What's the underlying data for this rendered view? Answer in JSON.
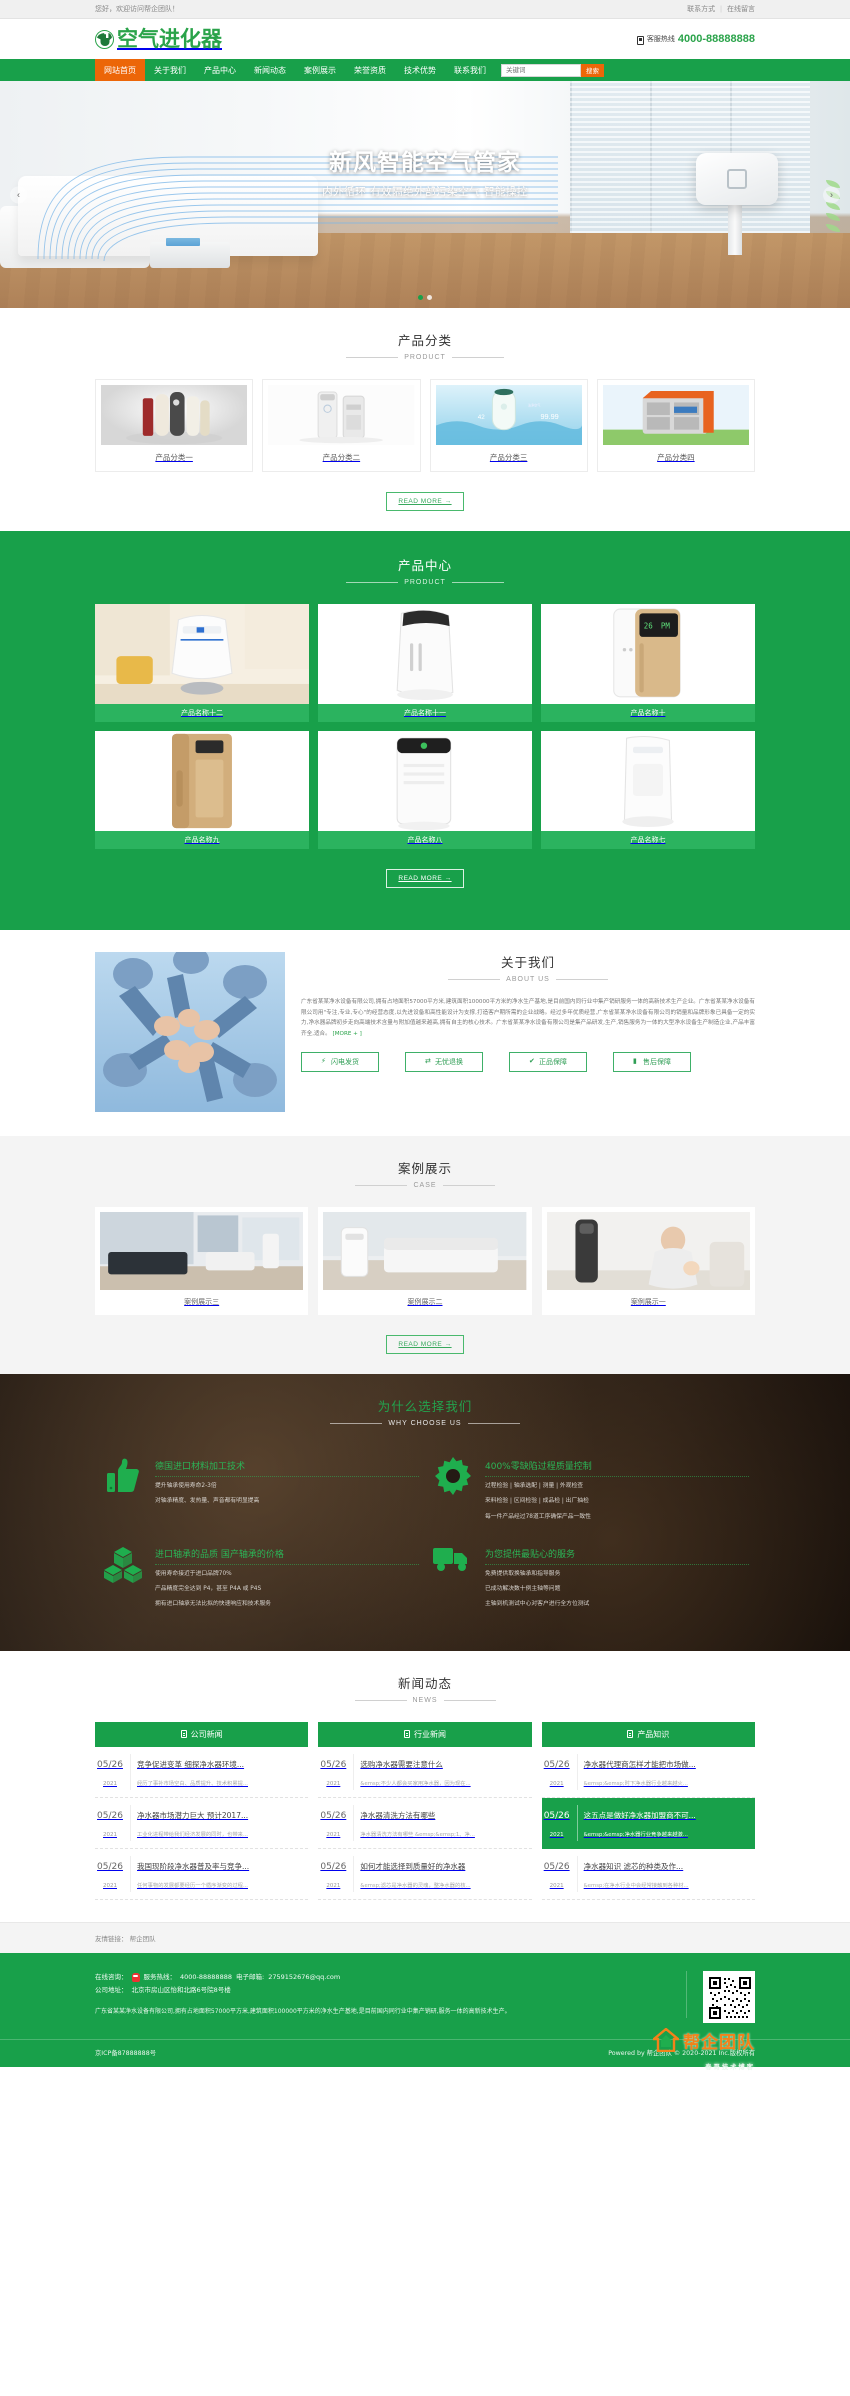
{
  "topbar": {
    "welcome": "您好，欢迎访问帮企团队！",
    "links": [
      {
        "label": "联系方式"
      },
      {
        "label": "在线留言"
      }
    ],
    "separator": "|"
  },
  "header": {
    "logo_text": "空气进化器",
    "logo_icon": "leaf-sprout-icon",
    "hotline_icon": "phone-icon",
    "hotline_label": "客服热线",
    "hotline_number": "4000-88888888"
  },
  "nav": {
    "items": [
      {
        "label": "网站首页",
        "active": true
      },
      {
        "label": "关于我们",
        "active": false
      },
      {
        "label": "产品中心",
        "active": false
      },
      {
        "label": "新闻动态",
        "active": false
      },
      {
        "label": "案例展示",
        "active": false
      },
      {
        "label": "荣誉资质",
        "active": false
      },
      {
        "label": "技术优势",
        "active": false
      },
      {
        "label": "联系我们",
        "active": false
      }
    ],
    "search_placeholder": "关键词",
    "search_value": "",
    "search_button": "搜索"
  },
  "hero": {
    "title": "新风智能空气管家",
    "subtitle": "内外循环 有效隔绝外部污染空气 智能操控",
    "prev_icon": "chevron-left-icon",
    "next_icon": "chevron-right-icon",
    "dots": 2,
    "active_dot": 0
  },
  "category": {
    "title": "产品分类",
    "subtitle": "PRODUCT",
    "items": [
      {
        "name": "产品分类一",
        "image": "water-purifier-group"
      },
      {
        "name": "产品分类二",
        "image": "tower-purifier-pair"
      },
      {
        "name": "产品分类三",
        "image": "water-splash-purifier"
      },
      {
        "name": "产品分类四",
        "image": "orange-air-cooler"
      }
    ],
    "read_more": "READ MORE →"
  },
  "product_center": {
    "title": "产品中心",
    "subtitle": "PRODUCT",
    "items": [
      {
        "name": "产品名称十二",
        "image": "white-purifier-room"
      },
      {
        "name": "产品名称十一",
        "image": "white-slim-purifier"
      },
      {
        "name": "产品名称十",
        "image": "gold-panel-purifier"
      },
      {
        "name": "产品名称九",
        "image": "gold-tall-purifier"
      },
      {
        "name": "产品名称八",
        "image": "white-green-purifier"
      },
      {
        "name": "产品名称七",
        "image": "white-curved-purifier"
      }
    ],
    "read_more": "READ MORE →"
  },
  "about": {
    "title": "关于我们",
    "subtitle": "ABOUT US",
    "image": "team-hands-together",
    "body": "广东省某某净水设备有限公司,拥有占地面积57000平方米,建筑面积100000平方米的净水生产基地,是目前国内同行业中集产销研服务一体的高新技术生产企业。广东省某某净水设备有限公司用\"专注,专业,专心\"的经营态度,以先进设备和高性能设计为支撑,打造客户期所需的企业战略。经过多年优质经营,广东省某某净水设备有限公司的销量和品牌形象已具备一定的实力,净水器品牌初步走向高端技术含量与附加值越来越高,拥有自主的核心技术。广东省某某净水设备有限公司是集产品研发,生产,销售服务为一体的大型净水设备生产制造企业,产品丰富齐全,适合。",
    "more_label": "[MORE + ]",
    "badges": [
      {
        "label": "闪电发货",
        "icon": "lightning-truck-icon"
      },
      {
        "label": "无忧退换",
        "icon": "exchange-icon"
      },
      {
        "label": "正品保障",
        "icon": "verified-check-icon"
      },
      {
        "label": "售后保障",
        "icon": "support-icon"
      }
    ]
  },
  "cases": {
    "title": "案例展示",
    "subtitle": "CASE",
    "items": [
      {
        "name": "案例展示三",
        "image": "living-room-interior"
      },
      {
        "name": "案例展示二",
        "image": "sofa-purifier-scene"
      },
      {
        "name": "案例展示一",
        "image": "mother-baby-purifier"
      }
    ],
    "read_more": "READ MORE →"
  },
  "why": {
    "title": "为什么选择我们",
    "subtitle": "WHY CHOOSE US",
    "items": [
      {
        "icon": "thumbs-up-icon",
        "heading": "德国进口材料加工技术",
        "lines": [
          "提升轴承使用寿命2-3倍",
          "对轴承精度、发热量、声音都有明显提高"
        ]
      },
      {
        "icon": "gear-icon",
        "heading": "400%零缺陷过程质量控制",
        "lines": [
          "过程检验 | 轴承选配 | 测量 | 外观检查",
          "来料检验 | 区间检验 | 成品检 | 出厂抽检",
          "每一件产品经过78道工序确保产品一致性"
        ]
      },
      {
        "icon": "boxes-icon",
        "heading": "进口轴承的品质 国产轴承的价格",
        "lines": [
          "使用寿命接近于进口品牌70%",
          "产品精度完全达到 P4，甚至 P4A 或 P4S",
          "拥有进口轴承无法比拟的快速响应和技术服务"
        ]
      },
      {
        "icon": "truck-icon",
        "heading": "为您提供最贴心的服务",
        "lines": [
          "免费提供取换轴承和指导服务",
          "已成功解决数十例主轴等问题",
          "主轴到机测试中心对客户进行全方位测试"
        ]
      }
    ]
  },
  "news": {
    "title": "新闻动态",
    "subtitle": "NEWS",
    "columns": [
      {
        "heading": "公司新闻",
        "icon": "news-doc-icon",
        "items": [
          {
            "day": "05/26",
            "year": "2021",
            "title": "竞争促进变革 细探净水器环境...",
            "desc": "经历了事补市场空白、品质提升、技术积累提...",
            "highlight": false
          },
          {
            "day": "05/26",
            "year": "2021",
            "title": "净水器市场潜力巨大 预计2017...",
            "desc": "工业化进程带给我们经济发展的同时，也带来...",
            "highlight": false
          },
          {
            "day": "05/26",
            "year": "2021",
            "title": "我国现阶段净水器普及率与竞争...",
            "desc": "任何事物的发展都要经历一个循序渐变的过程...",
            "highlight": false
          }
        ]
      },
      {
        "heading": "行业新闻",
        "icon": "news-doc-icon",
        "items": [
          {
            "day": "05/26",
            "year": "2021",
            "title": "选购净水器需要注意什么",
            "desc": "&emsp;不少人都会买家用净水器，因为现在...",
            "highlight": false
          },
          {
            "day": "05/26",
            "year": "2021",
            "title": "净水器清洗方法有哪些",
            "desc": "净水器清洗方法有哪些 &emsp;&emsp;1、净...",
            "highlight": false
          },
          {
            "day": "05/26",
            "year": "2021",
            "title": "如何才能选择到质量好的净水器",
            "desc": "&emsp;滤芯是净水器的灵魂，整净水器的核...",
            "highlight": false
          }
        ]
      },
      {
        "heading": "产品知识",
        "icon": "news-doc-icon",
        "items": [
          {
            "day": "05/26",
            "year": "2021",
            "title": "净水器代理商怎样才能把市场做...",
            "desc": "&emsp;&emsp;时下净水器行业越来越火...",
            "highlight": false
          },
          {
            "day": "05/26",
            "year": "2021",
            "title": "这五点是做好净水器加盟商不可...",
            "desc": "&emsp;&emsp;净水器行业竞争越来越激...",
            "highlight": true
          },
          {
            "day": "05/26",
            "year": "2021",
            "title": "净水器知识 滤芯的种类及作...",
            "desc": "&emsp;在净水行业中会经常接触到各种材...",
            "highlight": false
          }
        ]
      }
    ]
  },
  "friend_links": {
    "label": "友情链接：",
    "items": [
      {
        "label": "帮企团队"
      }
    ]
  },
  "footer": {
    "online_label": "在线咨询：",
    "qq_icon": "qq-penguin-icon",
    "service_label": "服务热线：",
    "service_phone": "4000-88888888",
    "email_label": "电子邮箱:",
    "email": "2759152676@qq.com",
    "address_label": "公司地址：",
    "address": "北京市房山区怡和北路6号院8号楼",
    "desc": "广东省某某净水设备有限公司,拥有占地面积57000平方米,建筑面积100000平方米的净水生产基地,是目前国内同行业中集产销研,服务一体的高新技术生产。",
    "qr_label": "qr-code",
    "icp": "京ICP备87888888号",
    "powered": "Powered by 帮企团队  © 2020-2021 Inc.版权所有"
  },
  "watermark": {
    "brand": "帮企团队",
    "blog": "春哥技术博客",
    "icon": "house-icon"
  },
  "colors": {
    "green": "#18a04a",
    "green_light": "#2bb35f",
    "orange": "#ec6608",
    "dark": "#241b14"
  }
}
